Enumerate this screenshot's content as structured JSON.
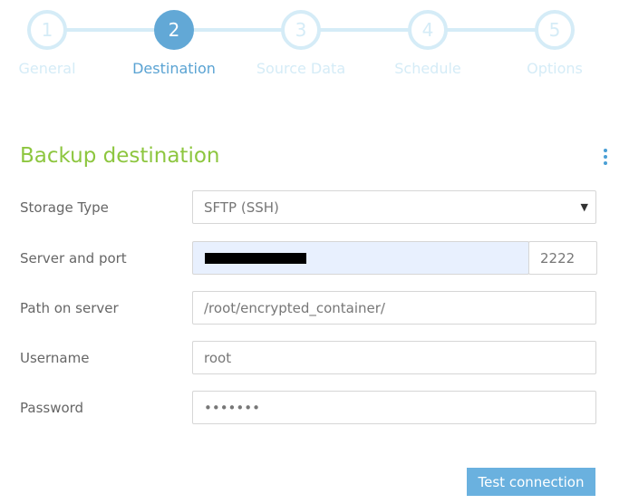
{
  "wizard": {
    "steps": [
      {
        "number": "1",
        "label": "General"
      },
      {
        "number": "2",
        "label": "Destination"
      },
      {
        "number": "3",
        "label": "Source Data"
      },
      {
        "number": "4",
        "label": "Schedule"
      },
      {
        "number": "5",
        "label": "Options"
      }
    ],
    "active_step": 2
  },
  "section": {
    "title": "Backup destination",
    "menu_icon": "kebab-vertical-icon"
  },
  "form": {
    "storage_type": {
      "label": "Storage Type",
      "value": "SFTP (SSH)"
    },
    "server": {
      "label": "Server and port",
      "value": "",
      "port": "2222"
    },
    "path": {
      "label": "Path on server",
      "value": "/root/encrypted_container/"
    },
    "username": {
      "label": "Username",
      "value": "root"
    },
    "password": {
      "label": "Password",
      "value": "•••••••"
    }
  },
  "actions": {
    "test_connection": "Test connection"
  },
  "colors": {
    "accent_blue": "#62a8d6",
    "inactive_step": "#d5ecf7",
    "section_green": "#8dc63f",
    "button_blue": "#6ab1df"
  }
}
